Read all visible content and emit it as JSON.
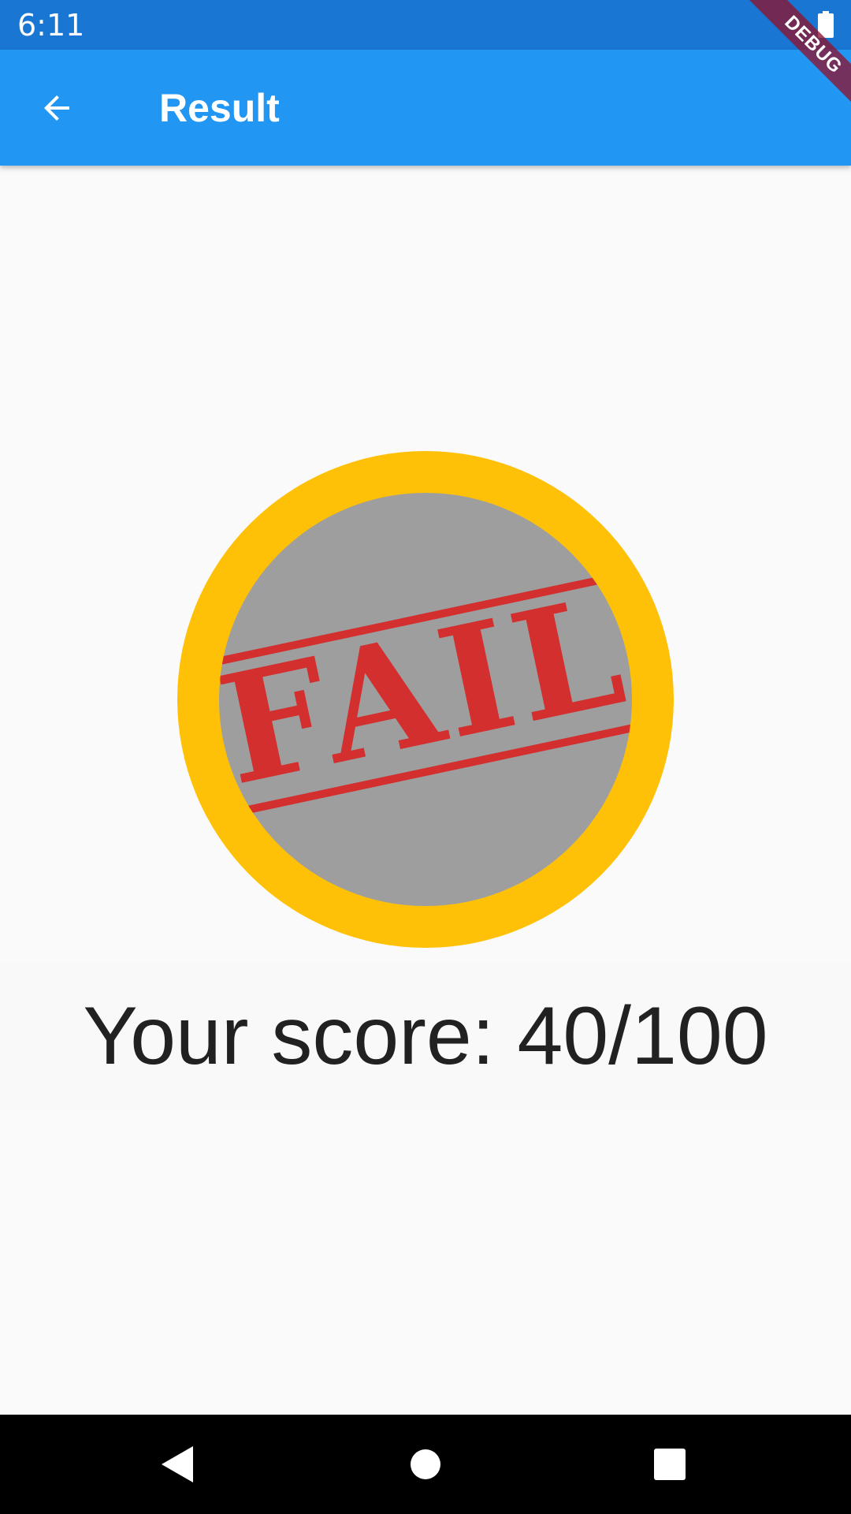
{
  "status_bar": {
    "time": "6:11",
    "battery_icon": "battery-full-icon"
  },
  "debug_banner": {
    "label": "DEBUG"
  },
  "app_bar": {
    "title": "Result",
    "back_icon": "arrow-back-icon"
  },
  "result": {
    "badge_text": "FAIL",
    "score_text": "Your score: 40/100"
  },
  "nav_bar": {
    "back_icon": "nav-back-icon",
    "home_icon": "nav-home-icon",
    "recents_icon": "nav-recents-icon"
  },
  "colors": {
    "status_bar": "#1976d2",
    "app_bar": "#2196f3",
    "badge_ring": "#ffc107",
    "badge_fill": "#9e9e9e",
    "stamp_red": "#d32f2f"
  }
}
